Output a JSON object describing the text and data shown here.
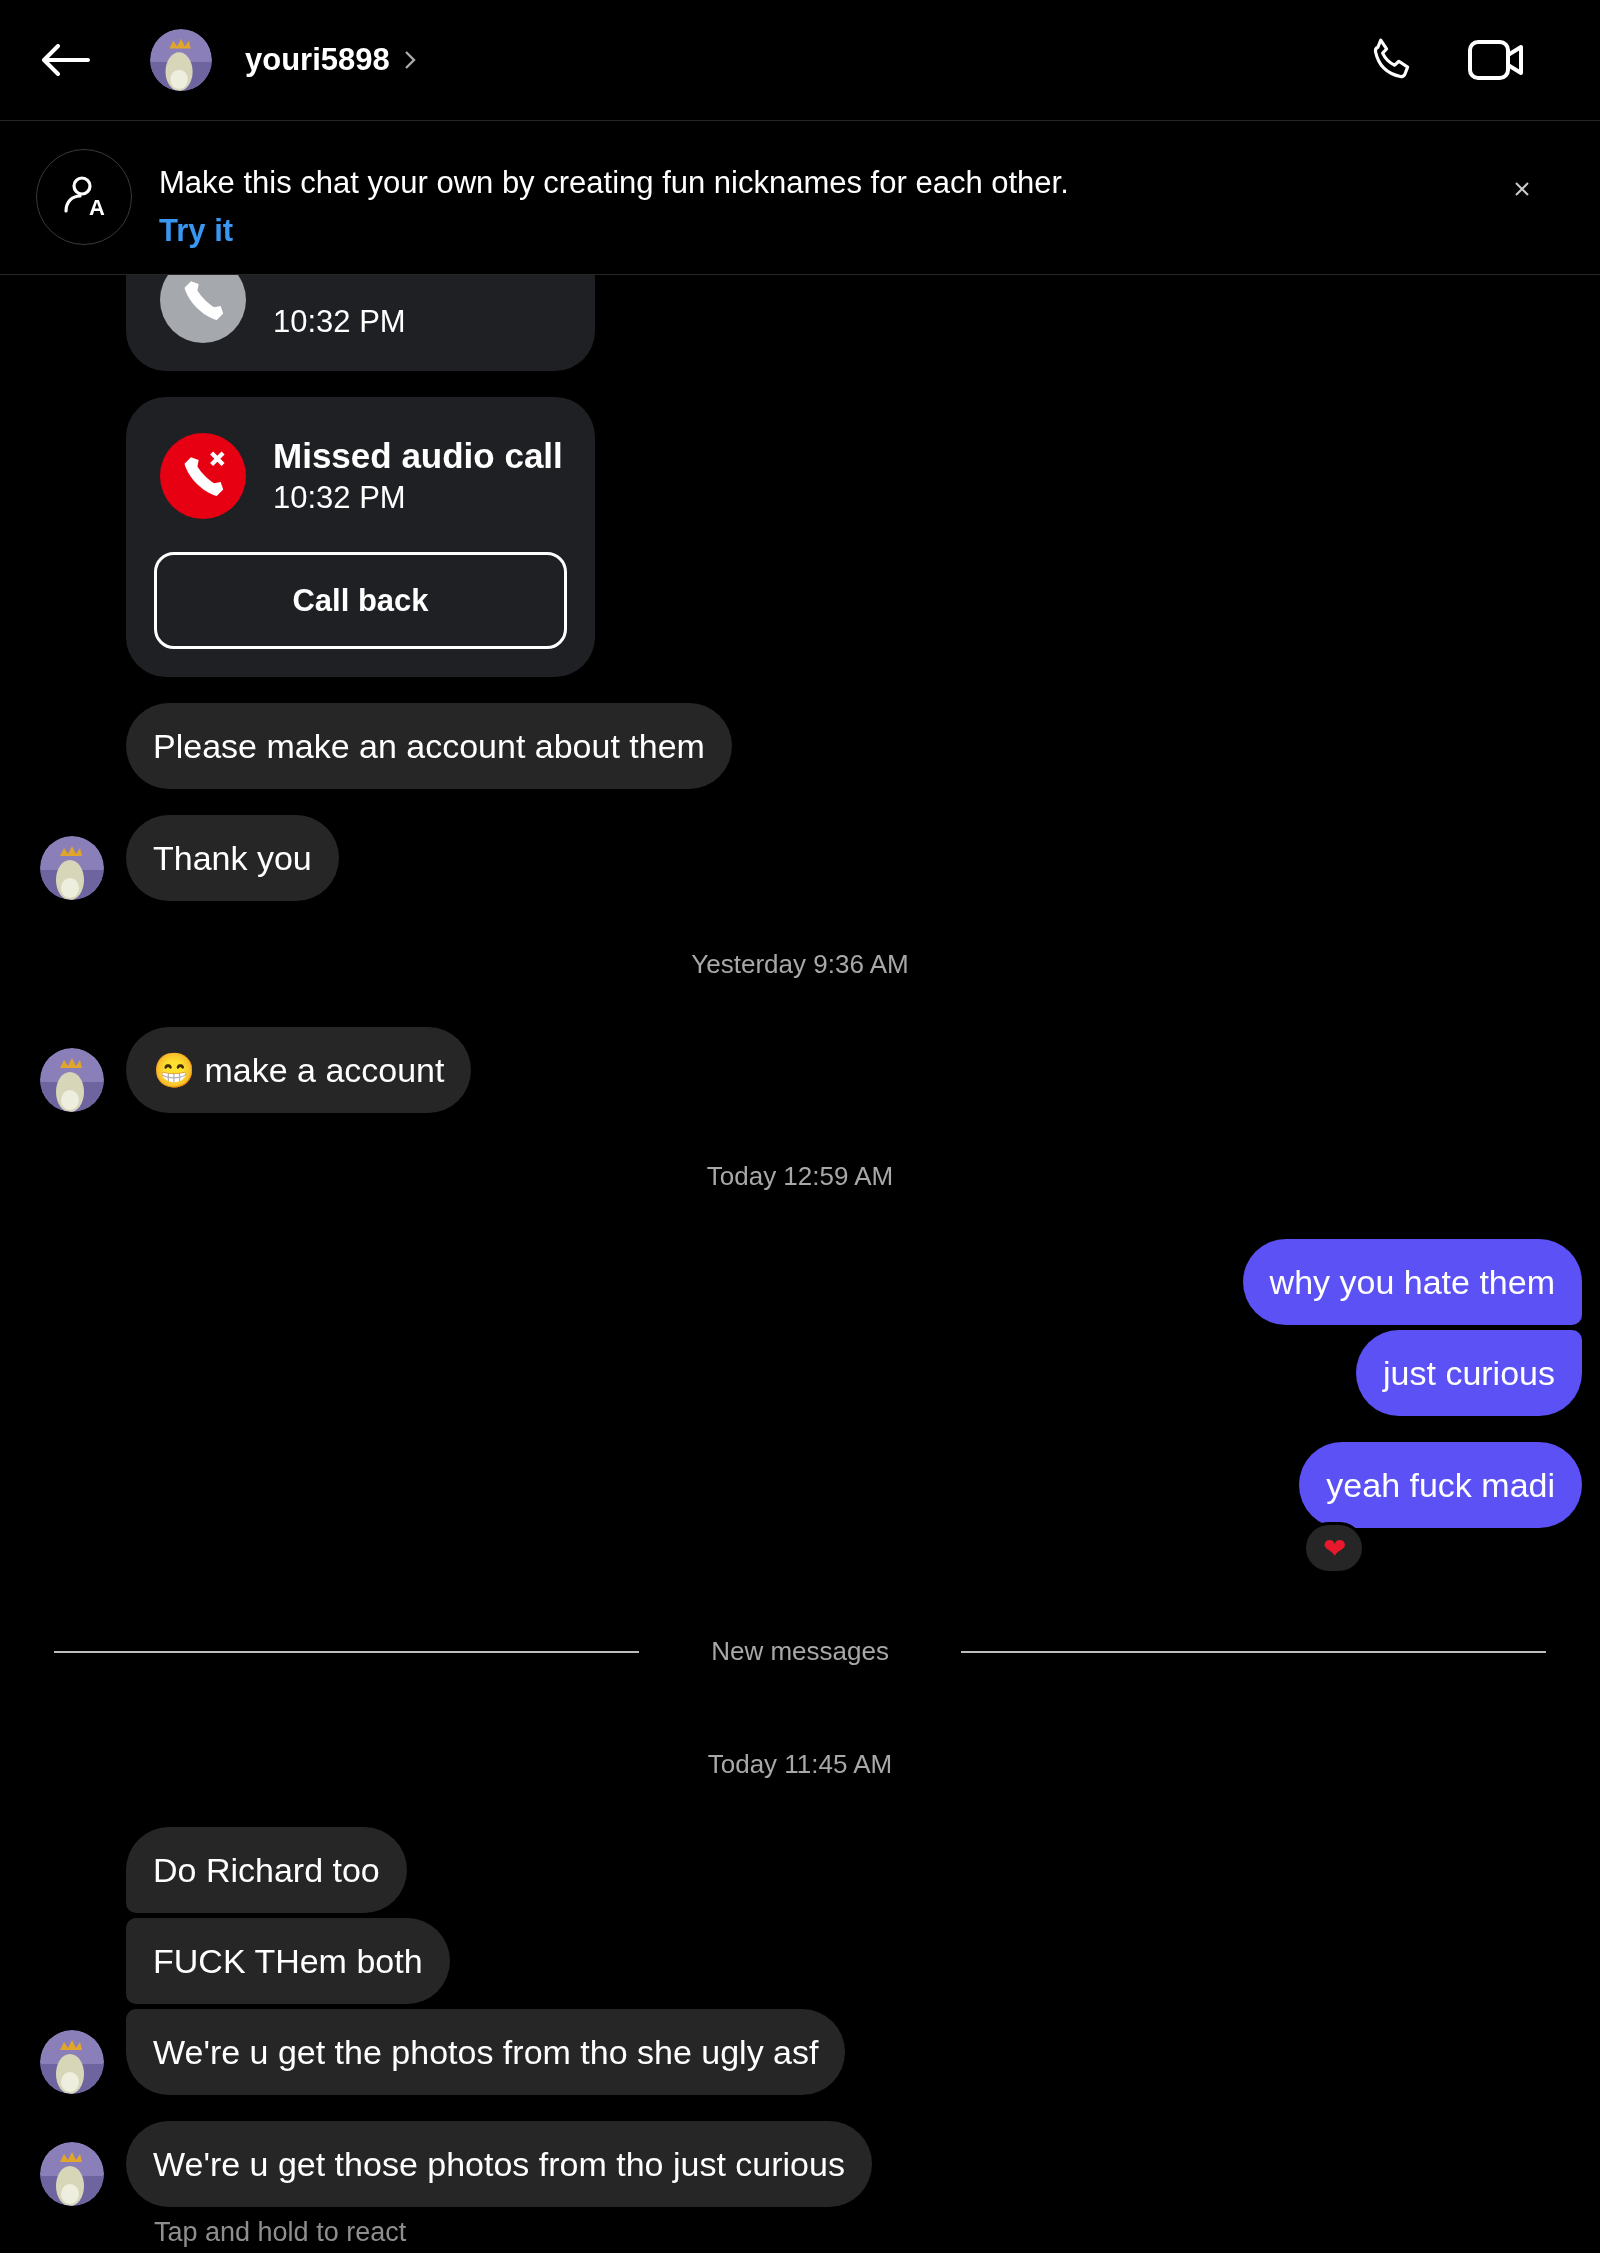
{
  "header": {
    "username": "youri5898"
  },
  "banner": {
    "icon_letter": "A",
    "text": "Make this chat your own by creating fun nicknames for each other.",
    "link": "Try it"
  },
  "thread": [
    {
      "kind": "call_started",
      "time": "10:32 PM"
    },
    {
      "kind": "call_missed",
      "title": "Missed audio call",
      "time": "10:32 PM",
      "button": "Call back"
    },
    {
      "kind": "incoming",
      "items": [
        {
          "text": "Please make an account about them",
          "avatar": false
        }
      ]
    },
    {
      "kind": "incoming",
      "items": [
        {
          "text": "Thank you",
          "avatar": true
        }
      ]
    },
    {
      "kind": "timestamp",
      "text": "Yesterday 9:36 AM"
    },
    {
      "kind": "incoming",
      "items": [
        {
          "text": "😁 make a account",
          "avatar": true
        }
      ]
    },
    {
      "kind": "timestamp",
      "text": "Today 12:59 AM"
    },
    {
      "kind": "outgoing",
      "items": [
        {
          "text": "why you hate them"
        },
        {
          "text": "just curious"
        }
      ]
    },
    {
      "kind": "outgoing",
      "items": [
        {
          "text": "yeah fuck madi",
          "reaction": "❤"
        }
      ]
    },
    {
      "kind": "divider",
      "text": "New messages"
    },
    {
      "kind": "timestamp",
      "text": "Today 11:45 AM"
    },
    {
      "kind": "incoming",
      "items": [
        {
          "text": "Do Richard too",
          "avatar": false
        },
        {
          "text": "FUCK THem both",
          "avatar": false
        },
        {
          "text": "We're u get the photos from tho she ugly asf",
          "avatar": true
        }
      ]
    },
    {
      "kind": "incoming",
      "items": [
        {
          "text": "We're u get those photos from tho just curious",
          "avatar": true
        }
      ]
    },
    {
      "kind": "hint",
      "text": "Tap and hold to react"
    }
  ]
}
